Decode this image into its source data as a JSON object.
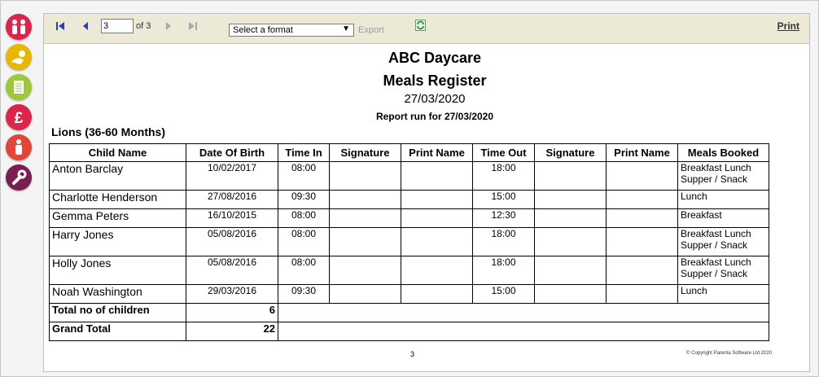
{
  "toolbar": {
    "page_value": "3",
    "of_pages": "of 3",
    "format_placeholder": "Select a format",
    "export_label": "Export",
    "print_label": "Print"
  },
  "report": {
    "title": "ABC Daycare",
    "subtitle": "Meals Register",
    "date": "27/03/2020",
    "run_for": "Report run for 27/03/2020",
    "group": "Lions (36-60 Months)",
    "columns": [
      "Child Name",
      "Date Of Birth",
      "Time In",
      "Signature",
      "Print Name",
      "Time Out",
      "Signature",
      "Print Name",
      "Meals Booked"
    ],
    "rows": [
      {
        "name": "Anton Barclay",
        "dob": "10/02/2017",
        "time_in": "08:00",
        "time_out": "18:00",
        "meals": "Breakfast Lunch Supper / Snack"
      },
      {
        "name": "Charlotte Henderson",
        "dob": "27/08/2016",
        "time_in": "09:30",
        "time_out": "15:00",
        "meals": "Lunch"
      },
      {
        "name": "Gemma Peters",
        "dob": "16/10/2015",
        "time_in": "08:00",
        "time_out": "12:30",
        "meals": "Breakfast"
      },
      {
        "name": "Harry Jones",
        "dob": "05/08/2016",
        "time_in": "08:00",
        "time_out": "18:00",
        "meals": "Breakfast Lunch Supper / Snack"
      },
      {
        "name": "Holly Jones",
        "dob": "05/08/2016",
        "time_in": "08:00",
        "time_out": "18:00",
        "meals": "Breakfast Lunch Supper / Snack"
      },
      {
        "name": "Noah Washington",
        "dob": "29/03/2016",
        "time_in": "09:30",
        "time_out": "15:00",
        "meals": "Lunch"
      }
    ],
    "total_label": "Total no of children",
    "total_value": "6",
    "grand_label": "Grand Total",
    "grand_value": "22",
    "page_number": "3",
    "copyright": "© Copyright Parenta Software Ltd 2020"
  },
  "colors": {
    "toolbar_bg": "#ecead7",
    "nav_blue": "#2a3db8"
  }
}
